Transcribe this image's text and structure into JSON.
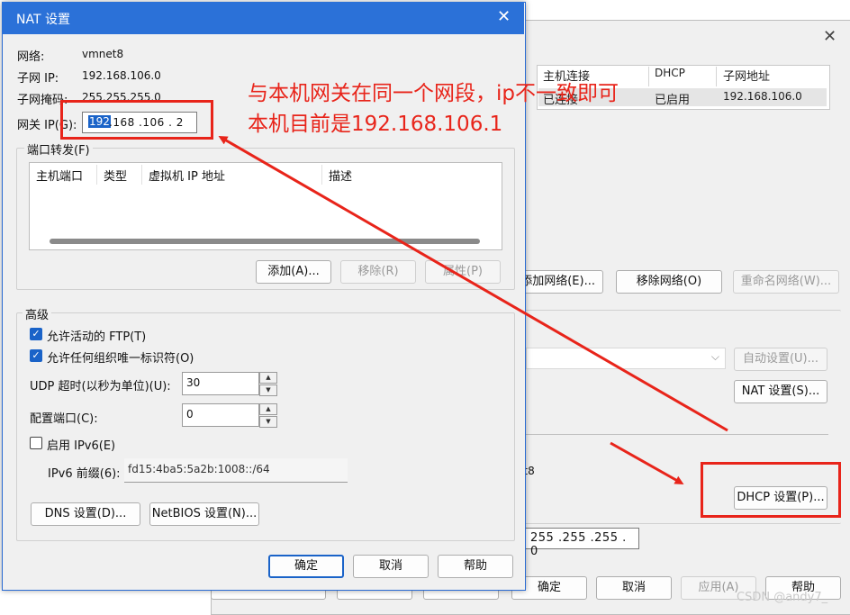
{
  "bg_window": {
    "network_table": {
      "headers": [
        "主机连接",
        "DHCP",
        "子网地址"
      ],
      "row": [
        "已连接",
        "已启用",
        "192.168.106.0"
      ]
    },
    "add_network_btn": "添加网络(E)...",
    "remove_network_btn": "移除网络(O)",
    "rename_network_btn": "重命名网络(W)...",
    "auto_settings_btn": "自动设置(U)...",
    "nat_settings_btn": "NAT 设置(S)...",
    "dhcp_settings_btn": "DHCP 设置(P)...",
    "partial_text": "et8",
    "subnet_mask_value": "255 .255 .255 . 0",
    "ok_btn": "确定",
    "cancel_btn": "取消",
    "apply_btn": "应用(A)",
    "help_btn": "帮助"
  },
  "nat_dialog": {
    "title": "NAT 设置",
    "network_label": "网络:",
    "network_value": "vmnet8",
    "subnet_ip_label": "子网 IP:",
    "subnet_ip_value": "192.168.106.0",
    "subnet_mask_label": "子网掩码:",
    "subnet_mask_value": "255.255.255.0",
    "gateway_label": "网关 IP(G):",
    "gateway_value": [
      " .168 .106 . 2"
    ],
    "gateway_selected": "192",
    "port_forwarding": {
      "label": "端口转发(F)",
      "columns": [
        "主机端口",
        "类型",
        "虚拟机 IP 地址",
        "描述"
      ],
      "add_btn": "添加(A)...",
      "remove_btn": "移除(R)",
      "properties_btn": "属性(P)"
    },
    "advanced": {
      "label": "高级",
      "allow_ftp": "允许活动的 FTP(T)",
      "allow_oui": "允许任何组织唯一标识符(O)",
      "udp_timeout_label": "UDP 超时(以秒为单位)(U):",
      "udp_timeout_value": "30",
      "config_port_label": "配置端口(C):",
      "config_port_value": "0",
      "enable_ipv6": "启用 IPv6(E)",
      "ipv6_prefix_label": "IPv6 前缀(6):",
      "ipv6_prefix_value": "fd15:4ba5:5a2b:1008::/64",
      "dns_btn": "DNS 设置(D)...",
      "netbios_btn": "NetBIOS 设置(N)..."
    },
    "ok_btn": "确定",
    "cancel_btn": "取消",
    "help_btn": "帮助"
  },
  "annotation": {
    "line1": "与本机网关在同一个网段，ip不一致即可",
    "line2": "本机目前是192.168.106.1",
    "color": "#e8241a"
  },
  "watermark": "CSDN @andy7_"
}
